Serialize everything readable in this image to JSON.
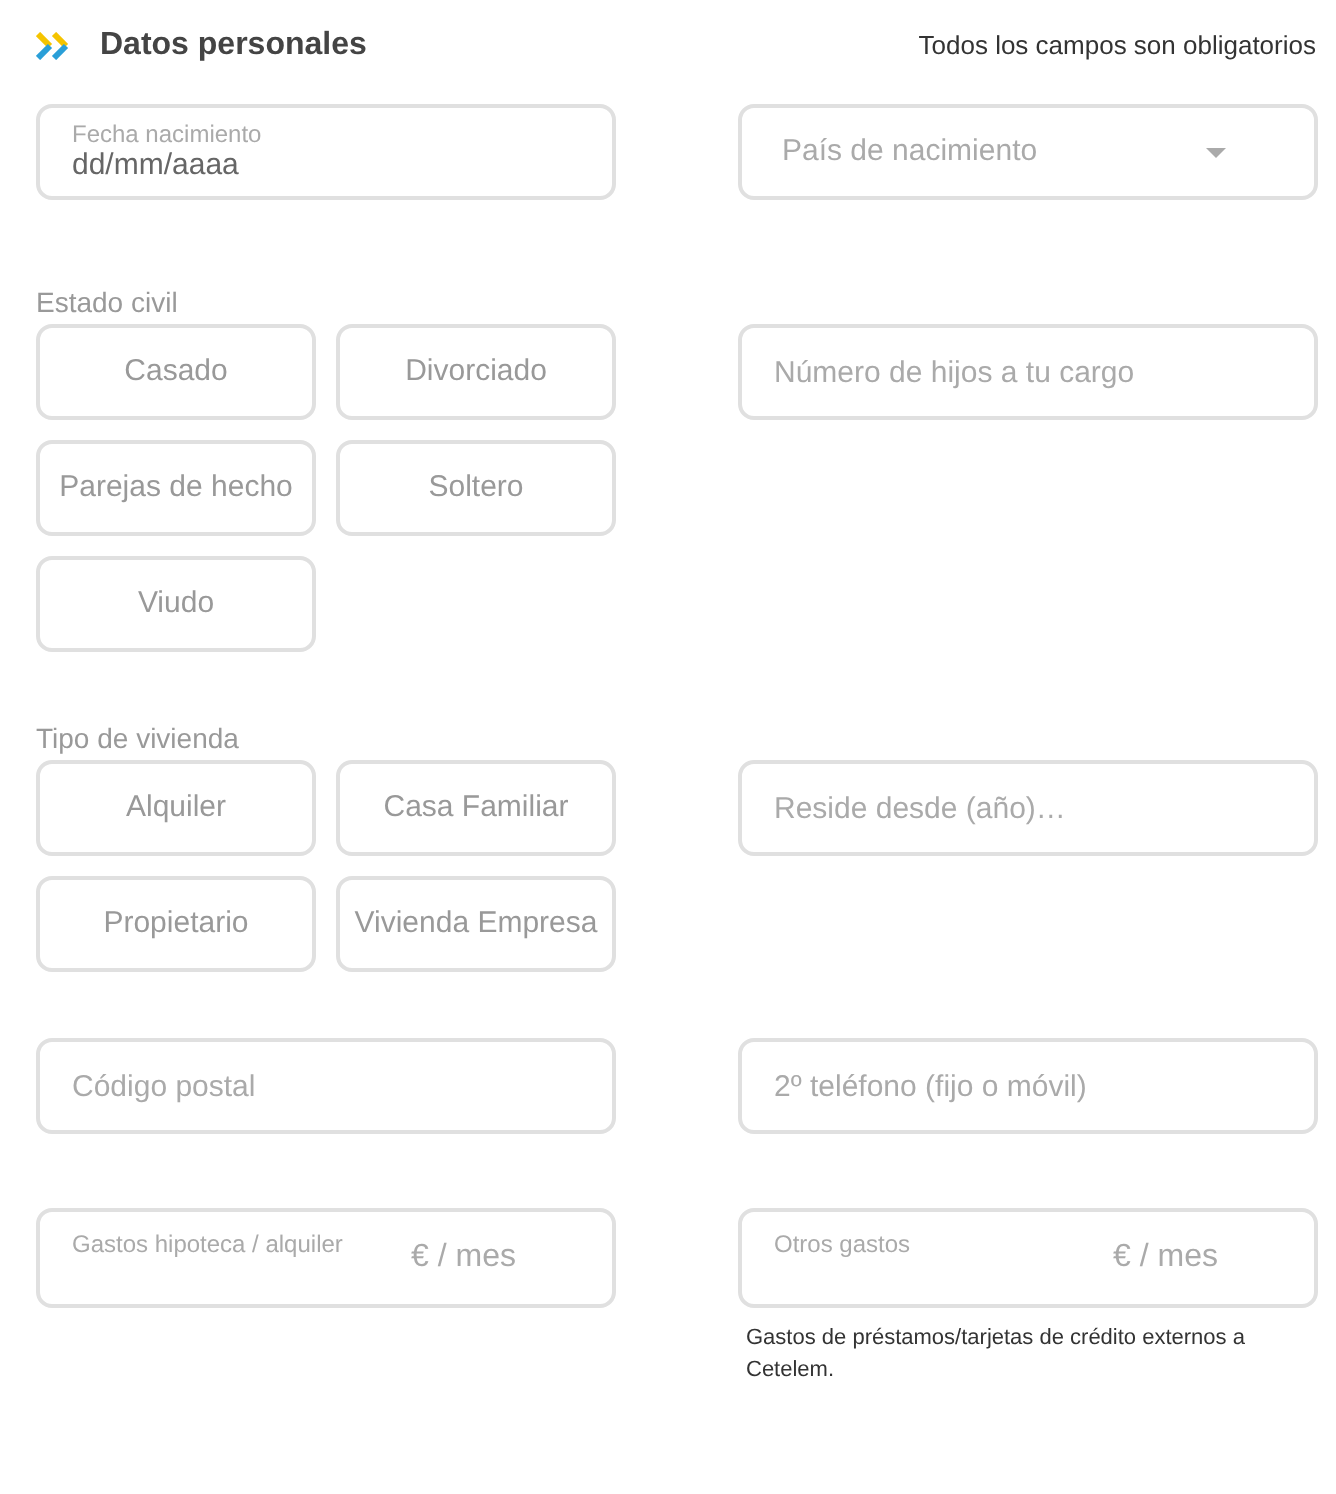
{
  "header": {
    "title": "Datos personales",
    "note": "Todos los campos son obligatorios"
  },
  "birth_date": {
    "label": "Fecha nacimiento",
    "placeholder": "dd/mm/aaaa"
  },
  "birth_country": {
    "placeholder": "País de nacimiento"
  },
  "marital_status": {
    "label": "Estado civil",
    "options": [
      {
        "label": "Casado",
        "selected": false
      },
      {
        "label": "Divorciado",
        "selected": false
      },
      {
        "label": "Parejas de hecho",
        "selected": false
      },
      {
        "label": "Soltero",
        "selected": false
      },
      {
        "label": "Viudo",
        "selected": false
      }
    ]
  },
  "children": {
    "placeholder": "Número de hijos a tu cargo"
  },
  "housing": {
    "label": "Tipo de vivienda",
    "options": [
      {
        "label": "Alquiler",
        "selected": false
      },
      {
        "label": "Casa Familiar",
        "selected": false
      },
      {
        "label": "Propietario",
        "selected": false
      },
      {
        "label": "Vivienda Empresa",
        "selected": false
      }
    ]
  },
  "resides_since": {
    "placeholder": "Reside desde (año)…"
  },
  "postal_code": {
    "placeholder": "Código postal"
  },
  "phone2": {
    "placeholder": "2º teléfono (fijo o móvil)"
  },
  "mortgage": {
    "label": "Gastos hipoteca / alquiler",
    "suffix": "€ / mes"
  },
  "other_expenses": {
    "label": "Otros gastos",
    "suffix": "€ / mes",
    "note": "Gastos de préstamos/tarjetas de crédito externos a Cetelem."
  }
}
